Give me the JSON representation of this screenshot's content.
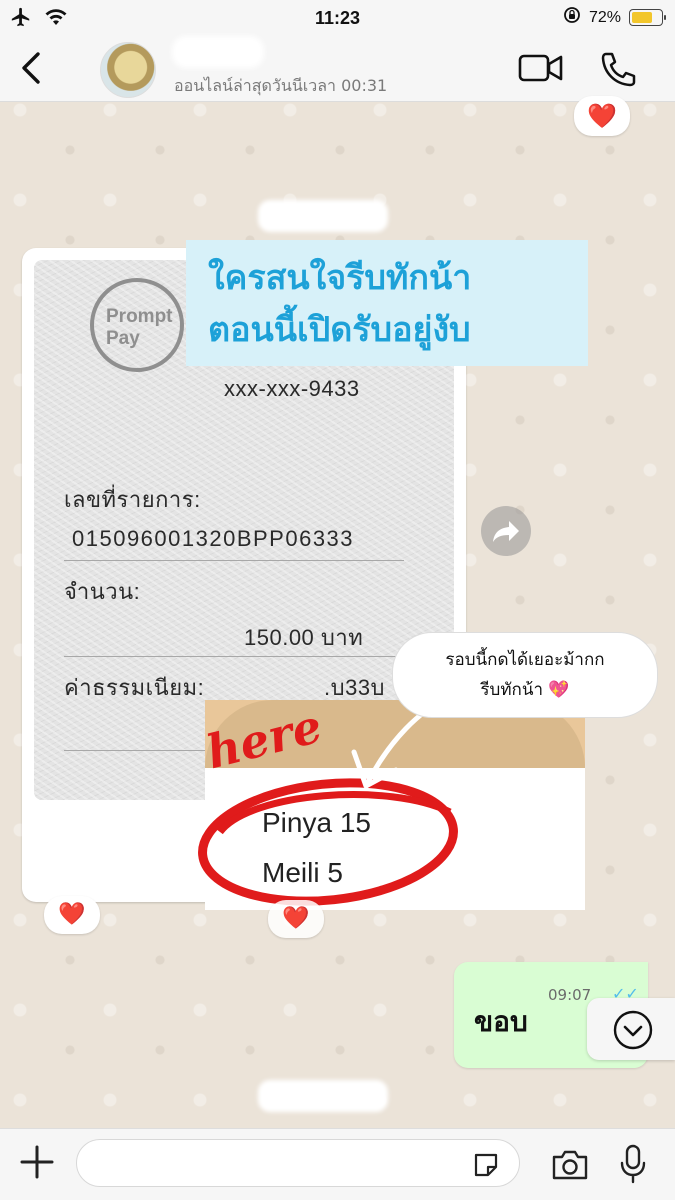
{
  "status_bar": {
    "time": "11:23",
    "battery_percent": "72%",
    "battery_level": 0.72,
    "airplane_icon": "airplane-icon",
    "wifi_icon": "wifi-icon",
    "rotation_lock_icon": "rotation-lock-icon"
  },
  "header": {
    "back_icon": "chevron-left-icon",
    "last_seen": "ออนไลน์ล่าสุดวันนีเวลา 00:31",
    "video_icon": "video-camera-icon",
    "call_icon": "phone-icon"
  },
  "messages": {
    "reaction_heart": "❤️",
    "payment_slip": {
      "logo_line1": "Prompt",
      "logo_line2": "Pay",
      "account": "xxx-xxx-9433",
      "ref_label": "เลขที่รายการ:",
      "ref_value": "015096001320BPP06333",
      "amount_label": "จำนวน:",
      "amount_value": "150.00 บาท",
      "fee_label": "ค่าธรรมเนียม:",
      "fee_value": ".บ33บ"
    },
    "caption_line1": "ใครสนใจรีบทักน้า",
    "caption_line2": "ตอนนี้เปิดรับอยู่งับ",
    "speech_line1": "รอบนี้กดได้เยอะม้ากก",
    "speech_line2": "รีบทักน้า 💖",
    "here_label": "here",
    "list_line1": "Pinya 15",
    "list_line2": "Meili 5",
    "sent_text": "ขอบ",
    "sent_time": "09:07"
  },
  "composer": {
    "input_value": "",
    "input_placeholder": ""
  },
  "colors": {
    "accent_blue": "#1da1d8",
    "circle_red": "#e01b1b",
    "sent_bubble": "#d9fdd3",
    "battery": "#f2c62b"
  }
}
